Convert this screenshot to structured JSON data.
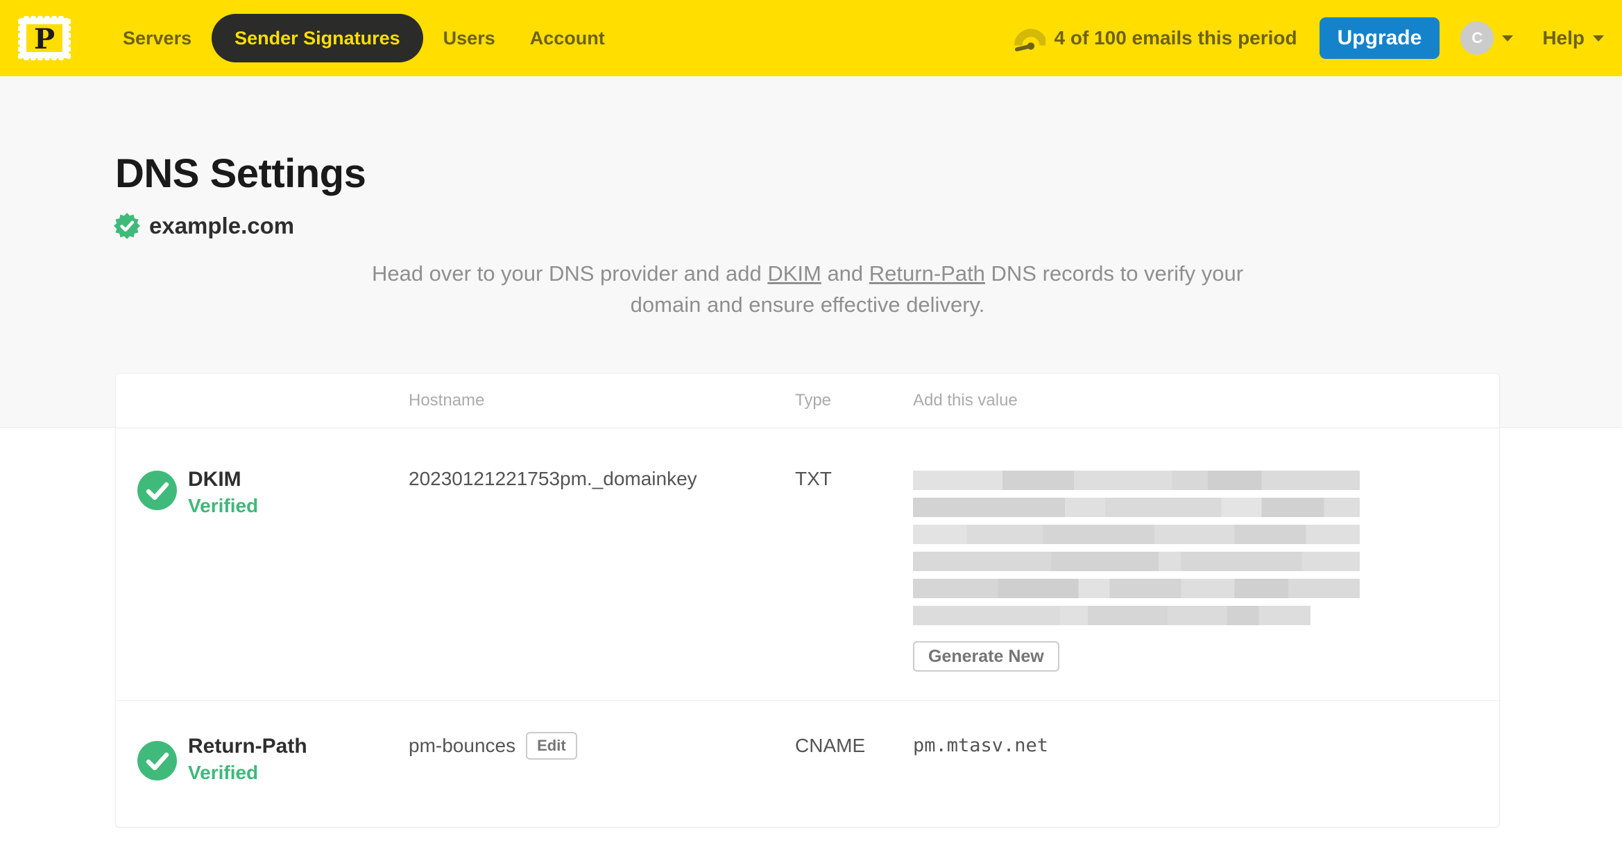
{
  "nav": {
    "brand_letter": "P",
    "items": [
      {
        "label": "Servers",
        "active": false
      },
      {
        "label": "Sender Signatures",
        "active": true
      },
      {
        "label": "Users",
        "active": false
      },
      {
        "label": "Account",
        "active": false
      }
    ],
    "usage_text": "4 of 100 emails this period",
    "upgrade_label": "Upgrade",
    "avatar_initial": "C",
    "help_label": "Help"
  },
  "page": {
    "title": "DNS Settings",
    "domain": "example.com",
    "intro": {
      "part1": "Head over to your DNS provider and add ",
      "link_dkim": "DKIM",
      "part2": " and ",
      "link_return_path": "Return-Path",
      "part3": " DNS records to verify your domain and ensure effective delivery."
    }
  },
  "table": {
    "headers": {
      "hostname": "Hostname",
      "type": "Type",
      "value": "Add this value"
    },
    "rows": [
      {
        "name": "DKIM",
        "status": "Verified",
        "hostname": "20230121221753pm._domainkey",
        "type": "TXT",
        "value": "",
        "value_redacted": true,
        "action_label": "Generate New"
      },
      {
        "name": "Return-Path",
        "status": "Verified",
        "hostname": "pm-bounces",
        "edit_label": "Edit",
        "type": "CNAME",
        "value": "pm.mtasv.net",
        "value_redacted": false
      }
    ]
  },
  "colors": {
    "brand_yellow": "#ffde00",
    "nav_text_olive": "#6d6214",
    "active_pill_bg": "#2b2b29",
    "upgrade_blue": "#1583cb",
    "verified_green": "#3fb87a",
    "page_bg": "#f8f8f8"
  },
  "icons": {
    "logo": "postmark-stamp-logo",
    "gauge": "usage-gauge-icon",
    "seal": "verified-seal-icon",
    "check": "check-circle-icon",
    "caret": "chevron-down-icon"
  }
}
